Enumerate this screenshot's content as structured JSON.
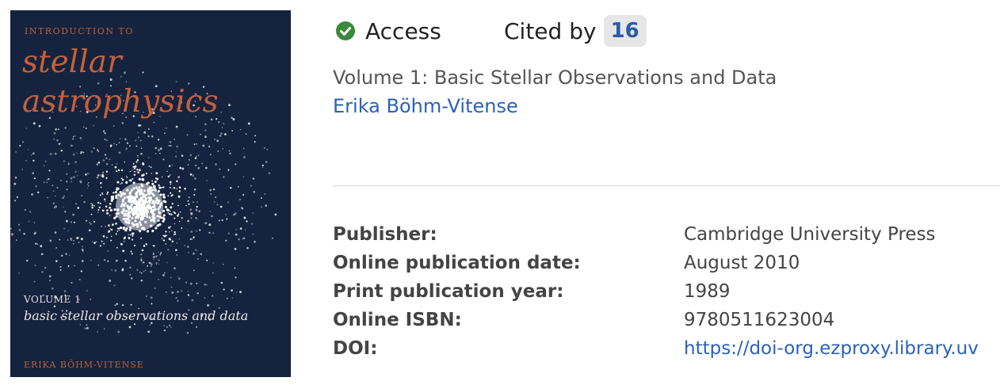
{
  "cover": {
    "series_text": "INTRODUCTION TO",
    "title_line1": "stellar",
    "title_line2": "astrophysics",
    "volume_label": "VOLUME 1",
    "subtitle": "basic stellar observations and data",
    "author": "ERIKA BÖHM-VITENSE",
    "background_color": "#16233e",
    "title_color": "#c4603c"
  },
  "status": {
    "access_icon": "check-circle-icon",
    "access_color": "#3a8a3a",
    "access_label": "Access",
    "cited_label": "Cited by",
    "cited_count": "16"
  },
  "book": {
    "volume_title": "Volume 1: Basic Stellar Observations and Data",
    "author": "Erika Böhm-Vitense"
  },
  "metadata": [
    {
      "key": "Publisher:",
      "value": "Cambridge University Press",
      "is_link": false
    },
    {
      "key": "Online publication date:",
      "value": "August 2010",
      "is_link": false
    },
    {
      "key": "Print publication year:",
      "value": "1989",
      "is_link": false
    },
    {
      "key": "Online ISBN:",
      "value": "9780511623004",
      "is_link": false
    },
    {
      "key": "DOI:",
      "value": "https://doi-org.ezproxy.library.uv",
      "is_link": true
    }
  ],
  "colors": {
    "link": "#2b62b6",
    "badge_bg": "#e6e6e6"
  }
}
